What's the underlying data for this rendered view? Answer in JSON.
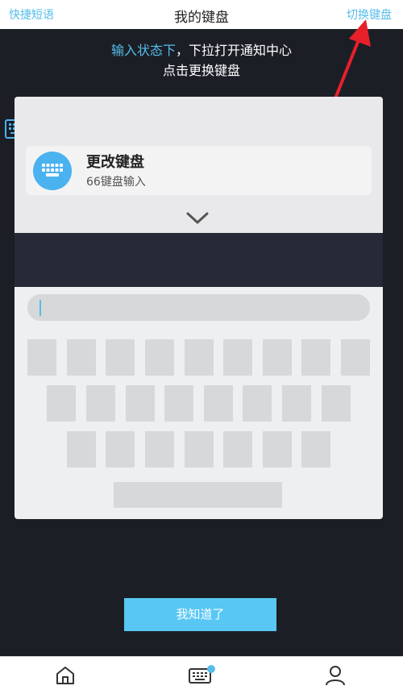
{
  "header": {
    "left_link": "快捷短语",
    "title": "我的键盘",
    "right_link": "切换键盘"
  },
  "hint": {
    "line1_highlight": "输入状态下",
    "line1_rest": "，下拉打开通知中心",
    "line2": "点击更换键盘"
  },
  "notification": {
    "title": "更改键盘",
    "subtitle": "66键盘输入"
  },
  "keyboard": {
    "row_counts": [
      9,
      8,
      7
    ]
  },
  "confirm_button": {
    "label": "我知道了"
  },
  "tabbar": {
    "items": [
      {
        "icon": "home-icon"
      },
      {
        "icon": "keyboard-icon",
        "badge": true
      },
      {
        "icon": "user-icon"
      }
    ]
  },
  "colors": {
    "accent": "#55bde9",
    "overlay": "#1c1e26",
    "button": "#58c7f4",
    "arrow": "#e8202a"
  }
}
